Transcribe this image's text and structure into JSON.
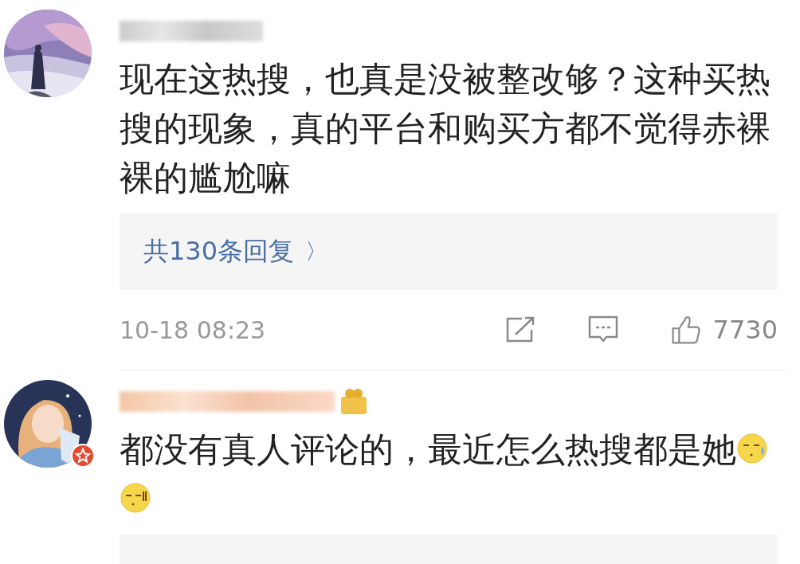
{
  "comments": [
    {
      "vip": false,
      "text": "现在这热搜，也真是没被整改够？这种买热搜的现象，真的平台和购买方都不觉得赤裸裸的尴尬嘛",
      "replies_link": "共130条回复",
      "replies_arrow": "〉",
      "time": "10-18 08:23",
      "likes": "7730"
    },
    {
      "verified": true,
      "vip": true,
      "text": "都没有真人评论的，最近怎么热搜都是她",
      "emojis": [
        {
          "kind": "sweat"
        },
        {
          "kind": "sleepy"
        }
      ]
    }
  ]
}
